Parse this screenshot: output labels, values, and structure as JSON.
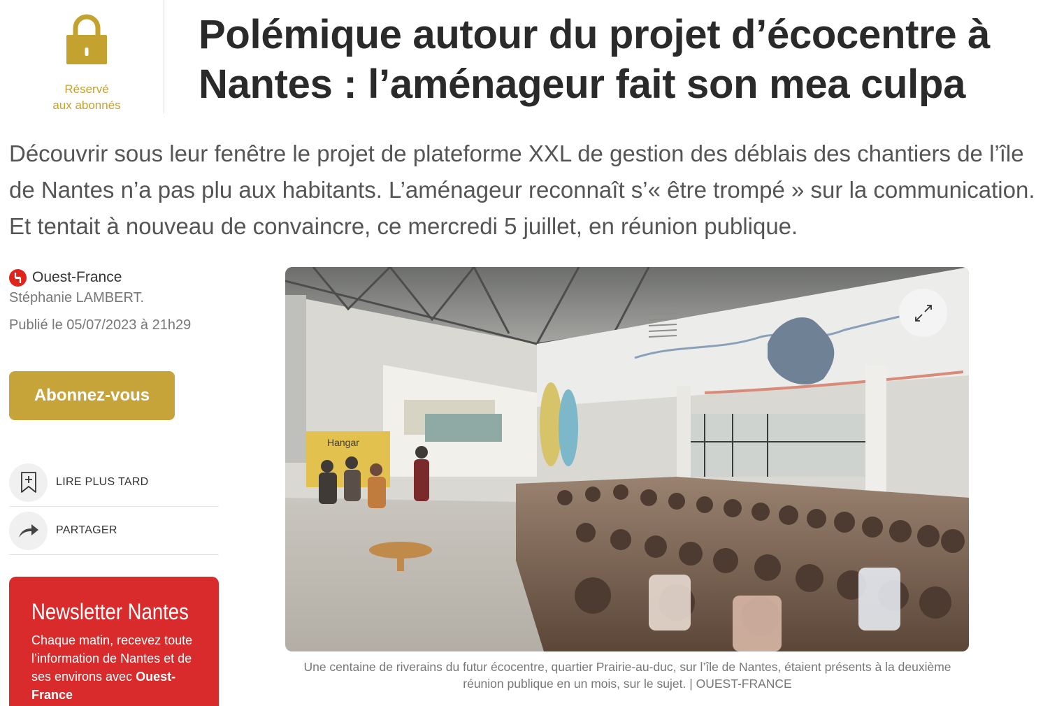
{
  "premium": {
    "label_line1": "Réservé",
    "label_line2": "aux abonnés",
    "lock_icon": "padlock-icon",
    "color": "#c4a230"
  },
  "article": {
    "title": "Polémique autour du projet d’écocentre à Nantes : l’aménageur fait son mea culpa",
    "lead": "Découvrir sous leur fenêtre le projet de plateforme XXL de gestion des déblais des chantiers de l’île de Nantes n’a pas plu aux habitants. L’aménageur reconnaît s’« être trompé » sur la communication. Et tentait à nouveau de convaincre, ce mercredi 5 juillet, en réunion publique."
  },
  "meta": {
    "source": "Ouest-France",
    "author": "Stéphanie LAMBERT.",
    "published": "Publié le 05/07/2023 à 21h29"
  },
  "subscribe": {
    "label": "Abonnez-vous",
    "color": "#c6a43a"
  },
  "actions": {
    "read_later": "LIRE PLUS TARD",
    "share": "PARTAGER"
  },
  "newsletter": {
    "title": "Newsletter Nantes",
    "text_before": "Chaque matin, recevez toute l’information de Nantes et de ses environs avec ",
    "brand": "Ouest-France",
    "color": "#d92b2b"
  },
  "photo": {
    "expand_icon": "expand-icon",
    "caption": "Une centaine de riverains du futur écocentre, quartier Prairie-au-duc, sur l’île de Nantes, étaient présents à la deuxième réunion publique en un mois, sur le sujet. |  OUEST-FRANCE",
    "sign_text": "Hangar"
  }
}
